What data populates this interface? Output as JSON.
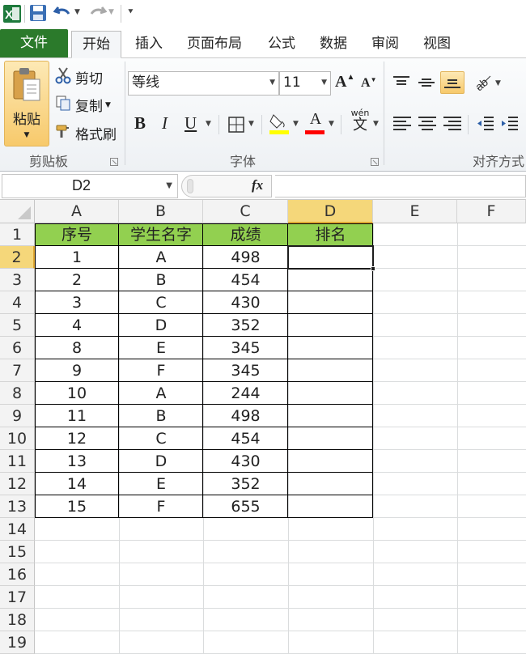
{
  "ribbon_tabs": [
    "文件",
    "开始",
    "插入",
    "页面布局",
    "公式",
    "数据",
    "审阅",
    "视图"
  ],
  "clipboard": {
    "paste_label": "粘贴",
    "cut_label": "剪切",
    "copy_label": "复制",
    "format_painter_label": "格式刷",
    "group_label": "剪贴板"
  },
  "font": {
    "font_name": "等线",
    "font_size": "11",
    "bold": "B",
    "italic": "I",
    "underline": "U",
    "font_color_glyph": "A",
    "wen_glyph": "wén",
    "wen_char": "文",
    "grow_glyph": "A",
    "shrink_glyph": "A",
    "group_label": "字体"
  },
  "alignment": {
    "group_label": "对齐方式"
  },
  "formula_bar": {
    "name_box": "D2",
    "fx": "fx",
    "formula": ""
  },
  "columns": [
    "A",
    "B",
    "C",
    "D",
    "E",
    "F"
  ],
  "selected_column": "D",
  "selected_row": 2,
  "row_numbers": [
    "1",
    "2",
    "3",
    "4",
    "5",
    "6",
    "7",
    "8",
    "9",
    "10",
    "11",
    "12",
    "13",
    "14",
    "15",
    "16",
    "17",
    "18",
    "19"
  ],
  "table": {
    "headers": [
      "序号",
      "学生名字",
      "成绩",
      "排名"
    ],
    "rows": [
      [
        "1",
        "A",
        "498",
        ""
      ],
      [
        "2",
        "B",
        "454",
        ""
      ],
      [
        "3",
        "C",
        "430",
        ""
      ],
      [
        "4",
        "D",
        "352",
        ""
      ],
      [
        "8",
        "E",
        "345",
        ""
      ],
      [
        "9",
        "F",
        "345",
        ""
      ],
      [
        "10",
        "A",
        "244",
        ""
      ],
      [
        "11",
        "B",
        "498",
        ""
      ],
      [
        "12",
        "C",
        "454",
        ""
      ],
      [
        "13",
        "D",
        "430",
        ""
      ],
      [
        "14",
        "E",
        "352",
        ""
      ],
      [
        "15",
        "F",
        "655",
        ""
      ]
    ]
  },
  "colors": {
    "file_tab": "#2b7a2b",
    "header_fill": "#92d050",
    "selection": "#f5d77a"
  }
}
